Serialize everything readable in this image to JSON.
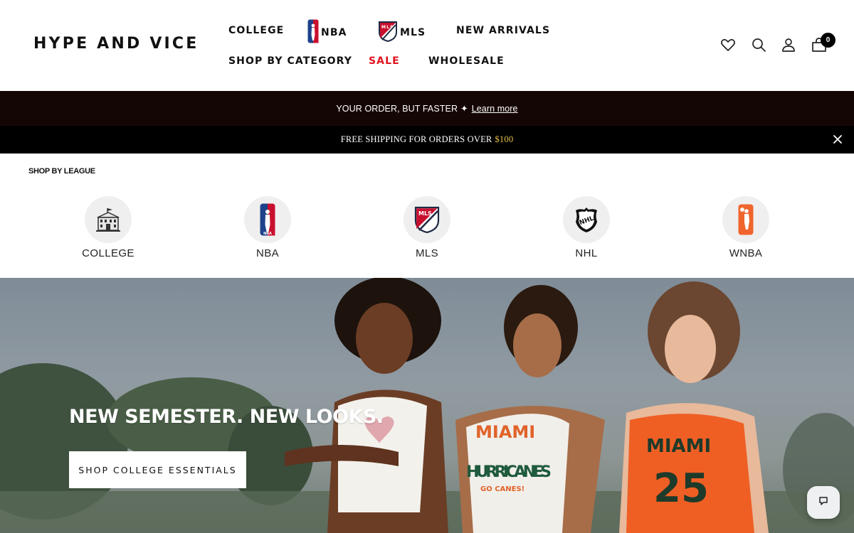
{
  "brand": {
    "logo_text": "HYPE AND VICE"
  },
  "nav": {
    "row1": [
      {
        "label": "COLLEGE"
      },
      {
        "label": "NBA",
        "icon": "nba-logo-icon"
      },
      {
        "label": "MLS",
        "icon": "mls-logo-icon"
      },
      {
        "label": "NEW ARRIVALS"
      }
    ],
    "row2": [
      {
        "label": "SHOP BY CATEGORY"
      },
      {
        "label": "SALE",
        "color": "#e0131e"
      },
      {
        "label": "WHOLESALE"
      }
    ]
  },
  "header_icons": [
    "heart-icon",
    "search-icon",
    "account-icon",
    "cart-icon"
  ],
  "cart": {
    "count": "0"
  },
  "announcement": {
    "text": "YOUR ORDER, BUT FASTER",
    "sparkle": "✦",
    "link": "Learn more"
  },
  "shipping_bar": {
    "text": "FREE SHIPPING FOR ORDERS OVER",
    "amount": "$100",
    "amount_color": "#e7c04c"
  },
  "leagues": {
    "title": "SHOP BY LEAGUE",
    "items": [
      {
        "label": "COLLEGE",
        "icon": "college-building-icon"
      },
      {
        "label": "NBA",
        "icon": "nba-logo-icon"
      },
      {
        "label": "MLS",
        "icon": "mls-logo-icon"
      },
      {
        "label": "NHL",
        "icon": "nhl-logo-icon"
      },
      {
        "label": "WNBA",
        "icon": "wnba-logo-icon"
      }
    ]
  },
  "hero": {
    "title": "NEW SEMESTER. NEW LOOKS.",
    "button": "SHOP COLLEGE ESSENTIALS",
    "jersey_texts": [
      "MIAMI",
      "HURRICANES",
      "GO CANES!",
      "MIAMI",
      "25"
    ]
  },
  "colors": {
    "sale": "#e0131e",
    "announcement_bg": "#150606",
    "shipping_bg": "#000000"
  }
}
